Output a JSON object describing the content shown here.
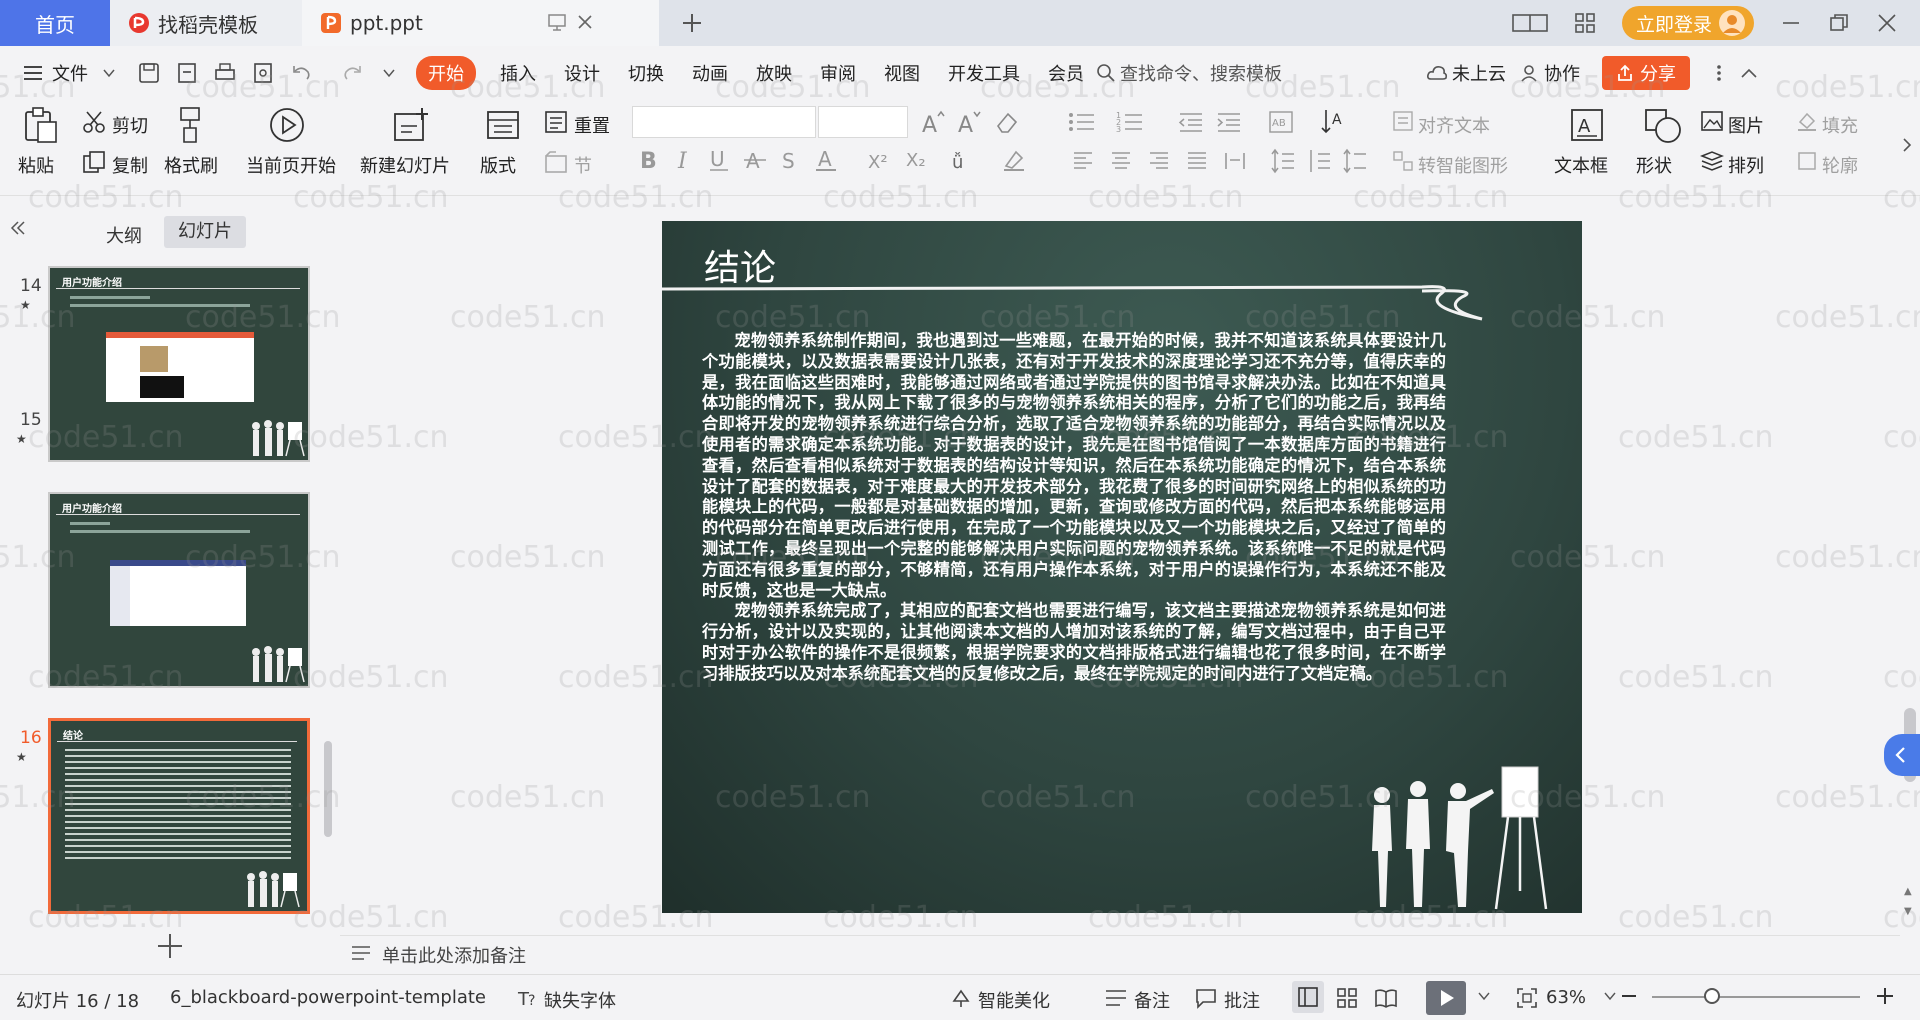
{
  "tabs": {
    "home": "首页",
    "template": "找稻壳模板",
    "doc": "ppt.ppt"
  },
  "account": {
    "login": "立即登录"
  },
  "menu": {
    "file": "文件",
    "items": [
      "开始",
      "插入",
      "设计",
      "切换",
      "动画",
      "放映",
      "审阅",
      "视图",
      "开发工具",
      "会员"
    ],
    "search": "查找命令、搜索模板",
    "cloud": "未上云",
    "collab": "协作",
    "share": "分享"
  },
  "ribbon": {
    "paste": "粘贴",
    "cut": "剪切",
    "copy": "复制",
    "format_painter": "格式刷",
    "play_current": "当前页开始",
    "new_slide": "新建幻灯片",
    "layout": "版式",
    "reset": "重置",
    "section": "节",
    "text_direction": "对齐文本",
    "smart_shape": "转智能图形",
    "textbox": "文本框",
    "shape": "形状",
    "picture": "图片",
    "fill": "填充",
    "arrange": "排列",
    "outline": "轮廓"
  },
  "leftpane": {
    "outline_tab": "大纲",
    "slides_tab": "幻灯片",
    "thumbs": [
      {
        "num": "14",
        "title": "用户功能介绍"
      },
      {
        "num": "15",
        "title": "用户功能介绍"
      },
      {
        "num": "16",
        "title": "结论"
      }
    ]
  },
  "slide": {
    "title": "结论",
    "para1": "宠物领养系统制作期间，我也遇到过一些难题，在最开始的时候，我并不知道该系统具体要设计几个功能模块，以及数据表需要设计几张表，还有对于开发技术的深度理论学习还不充分等，值得庆幸的是，我在面临这些困难时，我能够通过网络或者通过学院提供的图书馆寻求解决办法。比如在不知道具体功能的情况下，我从网上下载了很多的与宠物领养系统相关的程序，分析了它们的功能之后，我再结合即将开发的宠物领养系统进行综合分析，选取了适合宠物领养系统的功能部分，再结合实际情况以及使用者的需求确定本系统功能。对于数据表的设计，我先是在图书馆借阅了一本数据库方面的书籍进行查看，然后查看相似系统对于数据表的结构设计等知识，然后在本系统功能确定的情况下，结合本系统设计了配套的数据表，对于难度最大的开发技术部分，我花费了很多的时间研究网络上的相似系统的功能模块上的代码，一般都是对基础数据的增加，更新，查询或修改方面的代码，然后把本系统能够运用的代码部分在简单更改后进行使用，在完成了一个功能模块以及又一个功能模块之后，又经过了简单的测试工作，最终呈现出一个完整的能够解决用户实际问题的宠物领养系统。该系统唯一不足的就是代码方面还有很多重复的部分，不够精简，还有用户操作本系统，对于用户的误操作行为，本系统还不能及时反馈，这也是一大缺点。",
    "para2": "宠物领养系统完成了，其相应的配套文档也需要进行编写，该文档主要描述宠物领养系统是如何进行分析，设计以及实现的，让其他阅读本文档的人增加对该系统的了解，编写文档过程中，由于自己平时对于办公软件的操作不是很频繁，根据学院要求的文档排版格式进行编辑也花了很多时间，在不断学习排版技巧以及对本系统配套文档的反复修改之后，最终在学院规定的时间内进行了文档定稿。"
  },
  "notes": "单击此处添加备注",
  "status": {
    "slide_no": "幻灯片 16 / 18",
    "template": "6_blackboard-powerpoint-template",
    "missing_font": "缺失字体",
    "beautify": "智能美化",
    "notes": "备注",
    "comment": "批注",
    "zoom": "63%"
  },
  "watermark": "code51.cn",
  "colors": {
    "accent": "#f15b2a",
    "home_tab": "#4e74e8",
    "login": "#f0a52c",
    "slide_bg": "#2f4640"
  }
}
